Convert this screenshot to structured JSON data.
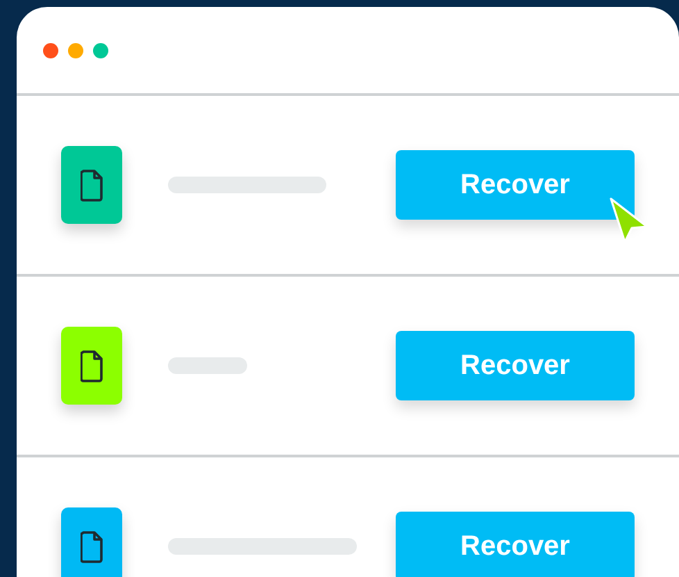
{
  "window": {
    "controls": [
      {
        "color": "#ff4f1a"
      },
      {
        "color": "#ffaa00"
      },
      {
        "color": "#00c896"
      }
    ]
  },
  "files": [
    {
      "color": "#00c896",
      "button": "Recover",
      "hovered": true
    },
    {
      "color": "#8cff00",
      "button": "Recover",
      "hovered": false
    },
    {
      "color": "#00b9f4",
      "button": "Recover",
      "hovered": false
    }
  ]
}
